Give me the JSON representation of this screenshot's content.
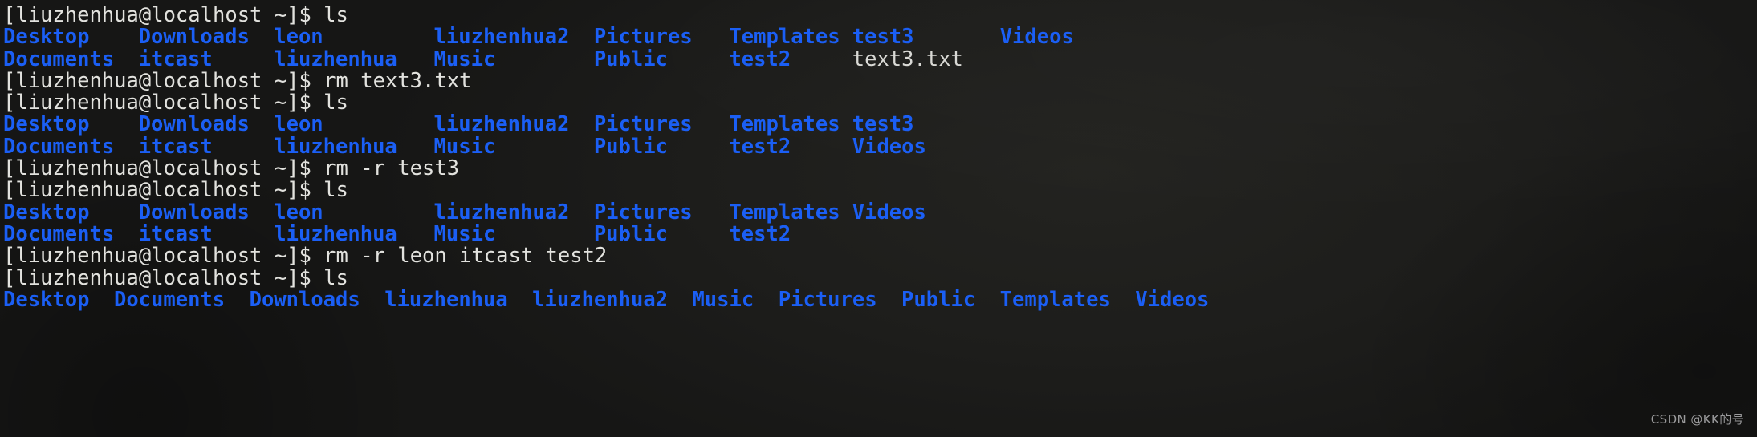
{
  "terminal": {
    "prompt": "[liuzhenhua@localhost ~]$ ",
    "colors": {
      "background": "#1d1d1b",
      "foreground": "#d8d8d4",
      "directory": "#1b5ff5",
      "file": "#d9d9d5"
    },
    "watermark": "CSDN @KK的号",
    "lines": [
      {
        "type": "command",
        "prompt": "[liuzhenhua@localhost ~]$ ",
        "command": "ls"
      },
      {
        "type": "output-row",
        "cells": [
          {
            "text": "Desktop",
            "kind": "dir",
            "cols": 11
          },
          {
            "text": "Downloads",
            "kind": "dir",
            "cols": 11
          },
          {
            "text": "leon",
            "kind": "dir",
            "cols": 13
          },
          {
            "text": "liuzhenhua2",
            "kind": "dir",
            "cols": 13
          },
          {
            "text": "Pictures",
            "kind": "dir",
            "cols": 11
          },
          {
            "text": "Templates",
            "kind": "dir",
            "cols": 10
          },
          {
            "text": "test3",
            "kind": "dir",
            "cols": 12
          },
          {
            "text": "Videos",
            "kind": "dir",
            "cols": 7
          }
        ]
      },
      {
        "type": "output-row",
        "cells": [
          {
            "text": "Documents",
            "kind": "dir",
            "cols": 11
          },
          {
            "text": "itcast",
            "kind": "dir",
            "cols": 11
          },
          {
            "text": "liuzhenhua",
            "kind": "dir",
            "cols": 13
          },
          {
            "text": "Music",
            "kind": "dir",
            "cols": 13
          },
          {
            "text": "Public",
            "kind": "dir",
            "cols": 11
          },
          {
            "text": "test2",
            "kind": "dir",
            "cols": 10
          },
          {
            "text": "text3.txt",
            "kind": "file",
            "cols": 12
          }
        ]
      },
      {
        "type": "command",
        "prompt": "[liuzhenhua@localhost ~]$ ",
        "command": "rm text3.txt"
      },
      {
        "type": "command",
        "prompt": "[liuzhenhua@localhost ~]$ ",
        "command": "ls"
      },
      {
        "type": "output-row",
        "cells": [
          {
            "text": "Desktop",
            "kind": "dir",
            "cols": 11
          },
          {
            "text": "Downloads",
            "kind": "dir",
            "cols": 11
          },
          {
            "text": "leon",
            "kind": "dir",
            "cols": 13
          },
          {
            "text": "liuzhenhua2",
            "kind": "dir",
            "cols": 13
          },
          {
            "text": "Pictures",
            "kind": "dir",
            "cols": 11
          },
          {
            "text": "Templates",
            "kind": "dir",
            "cols": 10
          },
          {
            "text": "test3",
            "kind": "dir",
            "cols": 12
          }
        ]
      },
      {
        "type": "output-row",
        "cells": [
          {
            "text": "Documents",
            "kind": "dir",
            "cols": 11
          },
          {
            "text": "itcast",
            "kind": "dir",
            "cols": 11
          },
          {
            "text": "liuzhenhua",
            "kind": "dir",
            "cols": 13
          },
          {
            "text": "Music",
            "kind": "dir",
            "cols": 13
          },
          {
            "text": "Public",
            "kind": "dir",
            "cols": 11
          },
          {
            "text": "test2",
            "kind": "dir",
            "cols": 10
          },
          {
            "text": "Videos",
            "kind": "dir",
            "cols": 12
          }
        ]
      },
      {
        "type": "command",
        "prompt": "[liuzhenhua@localhost ~]$ ",
        "command": "rm -r test3"
      },
      {
        "type": "command",
        "prompt": "[liuzhenhua@localhost ~]$ ",
        "command": "ls"
      },
      {
        "type": "output-row",
        "cells": [
          {
            "text": "Desktop",
            "kind": "dir",
            "cols": 11
          },
          {
            "text": "Downloads",
            "kind": "dir",
            "cols": 11
          },
          {
            "text": "leon",
            "kind": "dir",
            "cols": 13
          },
          {
            "text": "liuzhenhua2",
            "kind": "dir",
            "cols": 13
          },
          {
            "text": "Pictures",
            "kind": "dir",
            "cols": 11
          },
          {
            "text": "Templates",
            "kind": "dir",
            "cols": 10
          },
          {
            "text": "Videos",
            "kind": "dir",
            "cols": 7
          }
        ]
      },
      {
        "type": "output-row",
        "cells": [
          {
            "text": "Documents",
            "kind": "dir",
            "cols": 11
          },
          {
            "text": "itcast",
            "kind": "dir",
            "cols": 11
          },
          {
            "text": "liuzhenhua",
            "kind": "dir",
            "cols": 13
          },
          {
            "text": "Music",
            "kind": "dir",
            "cols": 13
          },
          {
            "text": "Public",
            "kind": "dir",
            "cols": 11
          },
          {
            "text": "test2",
            "kind": "dir",
            "cols": 10
          }
        ]
      },
      {
        "type": "command",
        "prompt": "[liuzhenhua@localhost ~]$ ",
        "command": "rm -r leon itcast test2"
      },
      {
        "type": "command",
        "prompt": "[liuzhenhua@localhost ~]$ ",
        "command": "ls"
      },
      {
        "type": "output-row",
        "cells": [
          {
            "text": "Desktop",
            "kind": "dir",
            "cols": 9
          },
          {
            "text": "Documents",
            "kind": "dir",
            "cols": 11
          },
          {
            "text": "Downloads",
            "kind": "dir",
            "cols": 11
          },
          {
            "text": "liuzhenhua",
            "kind": "dir",
            "cols": 12
          },
          {
            "text": "liuzhenhua2",
            "kind": "dir",
            "cols": 13
          },
          {
            "text": "Music",
            "kind": "dir",
            "cols": 7
          },
          {
            "text": "Pictures",
            "kind": "dir",
            "cols": 10
          },
          {
            "text": "Public",
            "kind": "dir",
            "cols": 8
          },
          {
            "text": "Templates",
            "kind": "dir",
            "cols": 11
          },
          {
            "text": "Videos",
            "kind": "dir",
            "cols": 6
          }
        ]
      }
    ]
  }
}
